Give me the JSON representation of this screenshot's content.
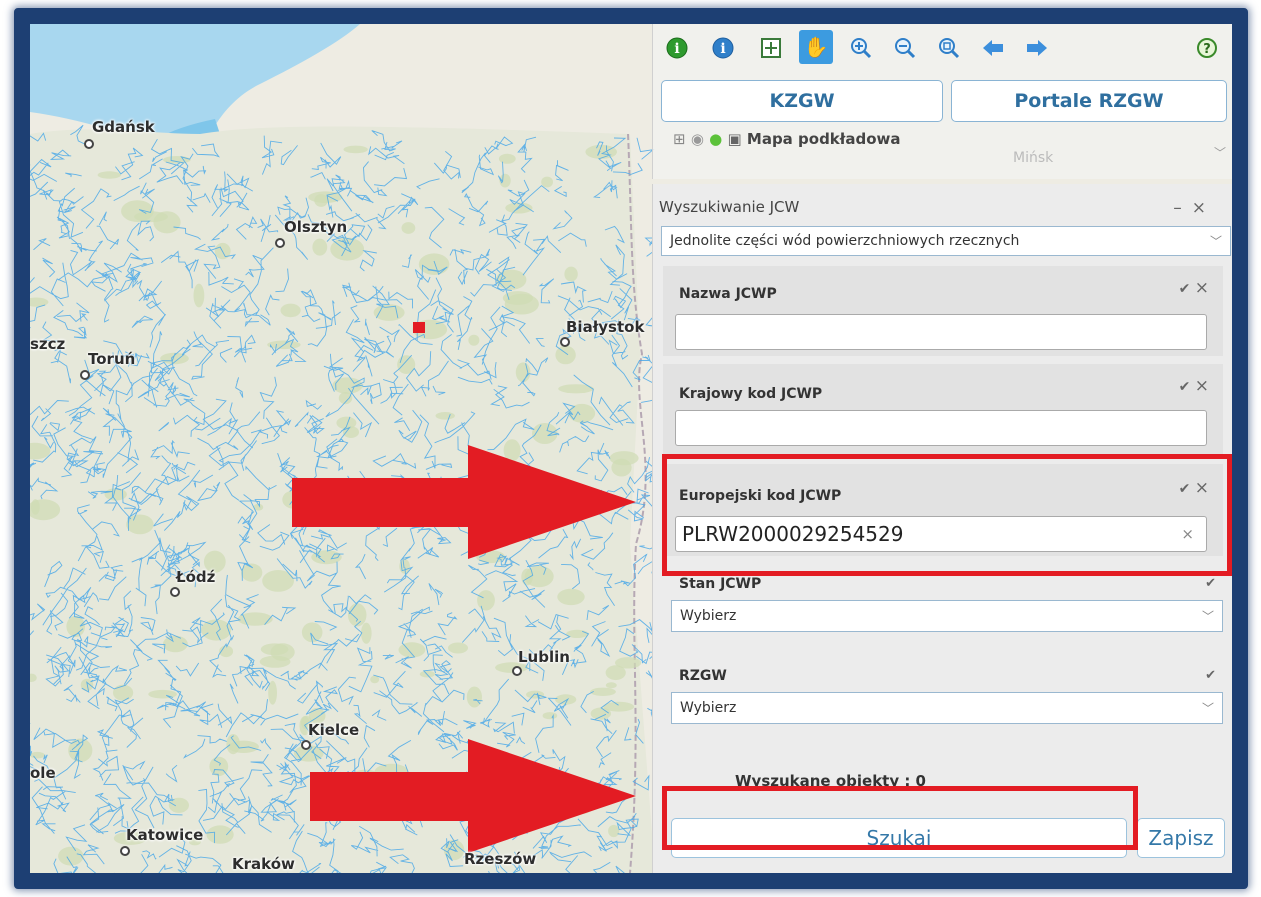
{
  "map": {
    "cities": [
      {
        "name": "Gdańsk"
      },
      {
        "name": "Olsztyn"
      },
      {
        "name": "Białystok"
      },
      {
        "name": "Toruń"
      },
      {
        "name": "Łódź"
      },
      {
        "name": "Lublin"
      },
      {
        "name": "Kielce"
      },
      {
        "name": "Katowice"
      },
      {
        "name": "Kraków"
      },
      {
        "name": "Rzeszów"
      }
    ],
    "edge_labels": {
      "left_top": "szcz",
      "left_bottom": "ole"
    },
    "faint_label": "Mińsk"
  },
  "toolbar": {
    "icons": [
      "info-green-icon",
      "info-blue-icon",
      "zoom-extent-icon",
      "pan-hand-icon",
      "zoom-in-icon",
      "zoom-out-icon",
      "zoom-rect-icon",
      "back-arrow-icon",
      "forward-arrow-icon",
      "help-icon"
    ],
    "kzgw_label": "KZGW",
    "portale_label": "Portale RZGW",
    "layer_label": "Mapa podkładowa"
  },
  "search": {
    "title": "Wyszukiwanie JCW",
    "minimize": "–",
    "close": "×",
    "type_select": "Jednolite części wód powierzchniowych rzecznych",
    "fields": [
      {
        "label": "Nazwa JCWP",
        "value": ""
      },
      {
        "label": "Krajowy kod JCWP",
        "value": ""
      },
      {
        "label": "Europejski kod JCWP",
        "value": "PLRW2000029254529"
      }
    ],
    "check": "✔",
    "cross": "×",
    "stan_label": "Stan JCWP",
    "stan_value": "Wybierz",
    "rzgw_label": "RZGW",
    "rzgw_value": "Wybierz",
    "found_text": "Wyszukane obiekty : 0",
    "szukaj_label": "Szukaj",
    "zapisz_label": "Zapisz"
  },
  "colors": {
    "frame": "#1d3f73",
    "accent_blue": "#3478a8",
    "highlight_red": "#e31c23",
    "river_blue": "#4aa8e8",
    "sea": "#a8d7ef"
  }
}
